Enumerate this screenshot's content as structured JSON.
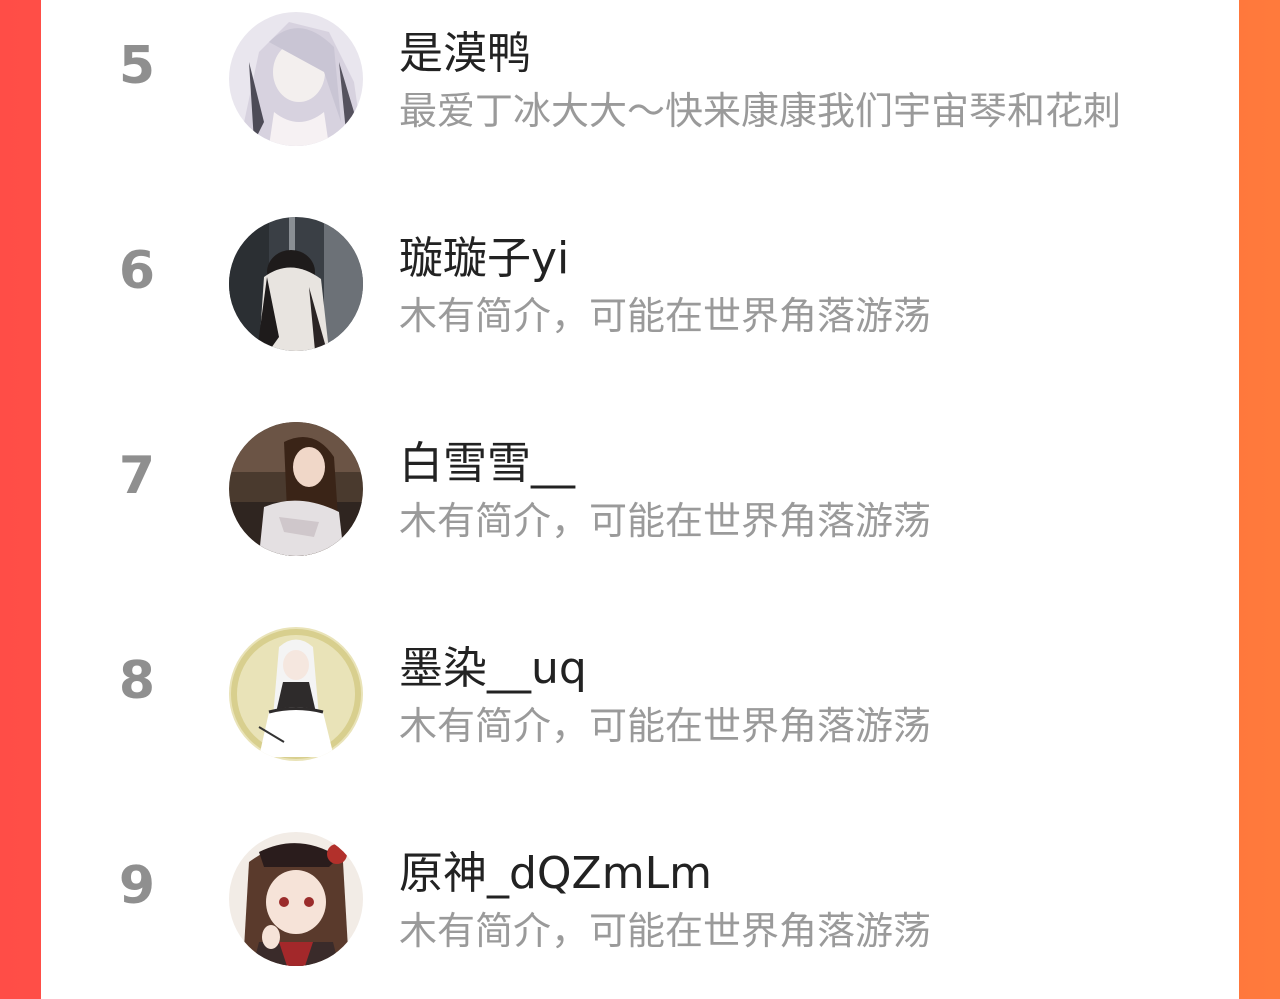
{
  "ranking": {
    "items": [
      {
        "rank": "5",
        "name": "是漠鸭",
        "bio": "最爱丁冰大大～快来康康我们宇宙琴和花刺"
      },
      {
        "rank": "6",
        "name": "璇璇子yi",
        "bio": "木有简介，可能在世界角落游荡"
      },
      {
        "rank": "7",
        "name": "白雪雪__",
        "bio": "木有简介，可能在世界角落游荡"
      },
      {
        "rank": "8",
        "name": "墨染__uq",
        "bio": "木有简介，可能在世界角落游荡"
      },
      {
        "rank": "9",
        "name": "原神_dQZmLm",
        "bio": "木有简介，可能在世界角落游荡"
      }
    ]
  },
  "colors": {
    "background_left": "#ff4d47",
    "background_right": "#ff7a3c",
    "rank_text": "#8f8f8f",
    "name_text": "#222222",
    "bio_text": "#9a9a9a"
  }
}
